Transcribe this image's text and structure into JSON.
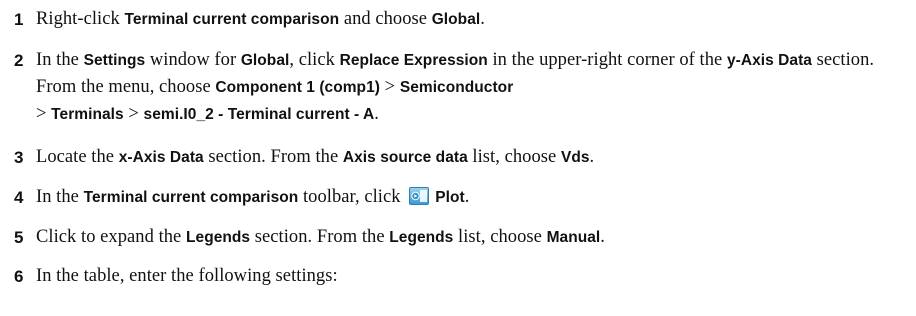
{
  "steps": [
    {
      "number": "1",
      "parts": {
        "a": "Right-click ",
        "b": "Terminal current comparison",
        "c": " and choose ",
        "d": "Global",
        "e": "."
      }
    },
    {
      "number": "2",
      "parts": {
        "a": "In the ",
        "b": "Settings",
        "c": " window for ",
        "d": "Global",
        "e": ", click ",
        "f": "Replace Expression",
        "g": " in the upper-right corner of the ",
        "h": "y-Axis Data",
        "i": " section. From the menu, choose ",
        "j": "Component 1 (comp1)",
        "k": " > ",
        "l": "Semiconductor",
        "m": " > ",
        "n": "Terminals",
        "o": " > ",
        "p": "semi.I0_2 - Terminal current - A",
        "q": "."
      }
    },
    {
      "number": "3",
      "parts": {
        "a": "Locate the ",
        "b": "x-Axis Data",
        "c": " section. From the ",
        "d": "Axis source data",
        "e": " list, choose ",
        "f": "Vds",
        "g": "."
      }
    },
    {
      "number": "4",
      "parts": {
        "a": "In the ",
        "b": "Terminal current comparison",
        "c": " toolbar, click ",
        "icon": "plot-icon",
        "d": "Plot",
        "e": "."
      }
    },
    {
      "number": "5",
      "parts": {
        "a": "Click to expand the ",
        "b": "Legends",
        "c": " section. From the ",
        "d": "Legends",
        "e": " list, choose ",
        "f": "Manual",
        "g": "."
      }
    },
    {
      "number": "6",
      "parts": {
        "a": "In the table, enter the following settings:"
      }
    }
  ]
}
